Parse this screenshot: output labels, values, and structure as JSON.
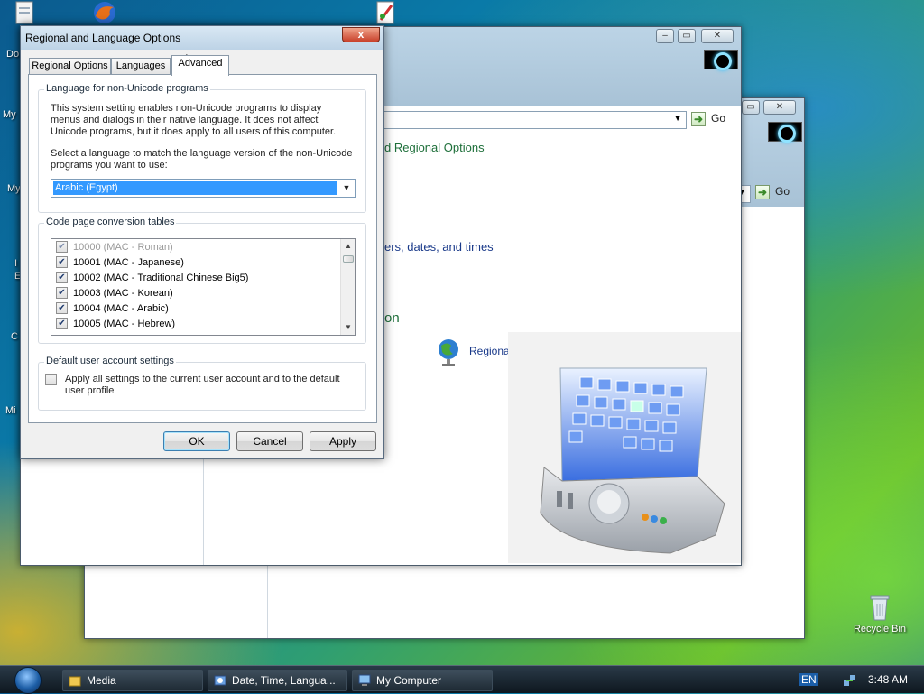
{
  "desktop": {
    "recycle_bin_label": "Recycle Bin",
    "cut_labels": [
      "Do",
      "My",
      "My",
      "I",
      "E",
      "C",
      "Mi"
    ]
  },
  "background_window_1": {
    "address_go_label": "Go",
    "link_regional_options": "d Regional Options",
    "link_numbers_dates": "ers, dates, and times",
    "link_partial": "on",
    "panel_item_label": "Regional and Language Options"
  },
  "background_window_2": {
    "address_go_label": "Go"
  },
  "dialog": {
    "title": "Regional and Language Options",
    "close_label": "x",
    "tabs": [
      {
        "label": "Regional Options",
        "active": false
      },
      {
        "label": "Languages",
        "active": false
      },
      {
        "label": "Advanced",
        "active": true
      }
    ],
    "non_unicode": {
      "legend": "Language for non-Unicode programs",
      "description": "This system setting enables non-Unicode programs to display menus and dialogs in their native language. It does not affect Unicode programs, but it does apply to all users of this computer.",
      "prompt": "Select a language to match the language version of the non-Unicode programs you want to use:",
      "selected_language": "Arabic (Egypt)"
    },
    "code_pages": {
      "legend": "Code page conversion tables",
      "items": [
        {
          "label": "10000 (MAC - Roman)",
          "checked": true,
          "disabled": true
        },
        {
          "label": "10001 (MAC - Japanese)",
          "checked": true,
          "disabled": false
        },
        {
          "label": "10002 (MAC - Traditional Chinese Big5)",
          "checked": true,
          "disabled": false
        },
        {
          "label": "10003 (MAC - Korean)",
          "checked": true,
          "disabled": false
        },
        {
          "label": "10004 (MAC - Arabic)",
          "checked": true,
          "disabled": false
        },
        {
          "label": "10005 (MAC - Hebrew)",
          "checked": true,
          "disabled": false
        }
      ]
    },
    "default_user": {
      "legend": "Default user account settings",
      "checkbox_label": "Apply all settings to the current user account and to the default user profile",
      "checked": false
    },
    "buttons": {
      "ok": "OK",
      "cancel": "Cancel",
      "apply": "Apply"
    }
  },
  "taskbar": {
    "items": [
      {
        "label": "Media"
      },
      {
        "label": "Date, Time, Langua..."
      },
      {
        "label": "My Computer"
      }
    ],
    "language_indicator": "EN",
    "clock": "3:48 AM"
  },
  "colors": {
    "selection": "#3399ff",
    "link_green": "#1e6f3a",
    "link_blue": "#1a3a8a"
  }
}
